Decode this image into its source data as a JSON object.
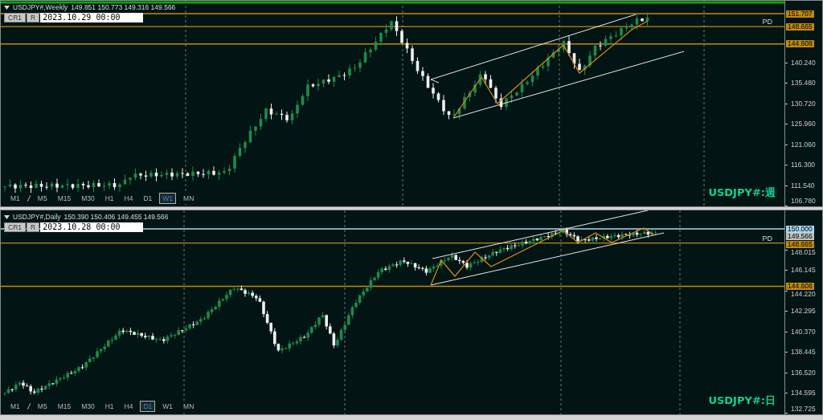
{
  "panes": [
    {
      "title": "USDJPY#,Weekly",
      "ohlc": "149.851 150.773 149.316 149.566",
      "buttons": [
        "CR1",
        "R"
      ],
      "date": "2023.10.29 00:00",
      "level_label": "PD",
      "axis_ticks": [
        "140.240",
        "135.480",
        "130.720",
        "125.960",
        "121.060",
        "116.300",
        "111.540",
        "106.780"
      ],
      "price_labels": [
        {
          "text": "151.707",
          "kind": "level"
        },
        {
          "text": "148.665",
          "kind": "level"
        },
        {
          "text": "144.608",
          "kind": "level"
        }
      ],
      "timeframes": [
        {
          "label": "M1",
          "selected": false
        },
        {
          "label": "M5",
          "selected": false
        },
        {
          "label": "M15",
          "selected": false
        },
        {
          "label": "M30",
          "selected": false
        },
        {
          "label": "H1",
          "selected": false
        },
        {
          "label": "H4",
          "selected": false
        },
        {
          "label": "D1",
          "selected": false
        },
        {
          "label": "W1",
          "selected": true
        },
        {
          "label": "MN",
          "selected": false
        }
      ],
      "symbol_label": "USDJPY#:週"
    },
    {
      "title": "USDJPY#,Daily",
      "ohlc": "150.390 150.406 149.455 149.566",
      "buttons": [
        "CR1",
        "R"
      ],
      "date": "2023.10.28 00:00",
      "level_label": "PD",
      "axis_ticks": [
        "148.015",
        "146.145",
        "144.220",
        "142.295",
        "140.370",
        "138.445",
        "136.520",
        "134.595",
        "132.725"
      ],
      "price_labels": [
        {
          "text": "150.000",
          "kind": "line"
        },
        {
          "text": "149.566",
          "kind": "bid"
        },
        {
          "text": "148.665",
          "kind": "level"
        },
        {
          "text": "144.608",
          "kind": "level"
        }
      ],
      "timeframes": [
        {
          "label": "M1",
          "selected": false
        },
        {
          "label": "M5",
          "selected": false
        },
        {
          "label": "M15",
          "selected": false
        },
        {
          "label": "M30",
          "selected": false
        },
        {
          "label": "H1",
          "selected": false
        },
        {
          "label": "H4",
          "selected": false
        },
        {
          "label": "D1",
          "selected": true
        },
        {
          "label": "W1",
          "selected": false
        },
        {
          "label": "MN",
          "selected": false
        }
      ],
      "symbol_label": "USDJPY#:日"
    }
  ]
}
